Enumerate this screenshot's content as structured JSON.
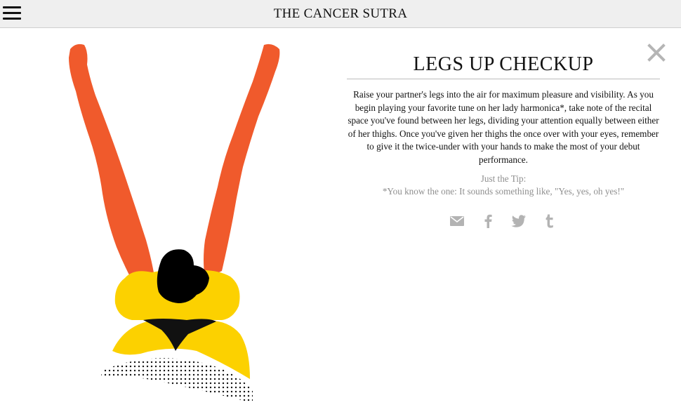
{
  "header": {
    "title": "THE CANCER SUTRA",
    "menu_icon": "hamburger-menu-icon"
  },
  "article": {
    "title": "LEGS UP CHECKUP",
    "body": "Raise your partner's legs into the air for maximum pleasure and visibility. As you begin playing your favorite tune on her lady harmonica*, take note of the recital space you've found between her legs, dividing your attention equally between either of her thighs. Once you've given her thighs the once over with your eyes, remember to give it the twice-under with your hands to make the most of your debut performance.",
    "tip_label": "Just the Tip:",
    "tip_text": "*You know the one: It sounds something like, \"Yes, yes, oh yes!\""
  },
  "share": {
    "icons": [
      "email-icon",
      "facebook-icon",
      "twitter-icon",
      "tumblr-icon"
    ]
  },
  "close_icon": "close-icon",
  "colors": {
    "legs": "#f05a2c",
    "body": "#fcd100",
    "hair": "#000000",
    "topbar": "#efefef",
    "share_gray": "#b3b3b3"
  }
}
